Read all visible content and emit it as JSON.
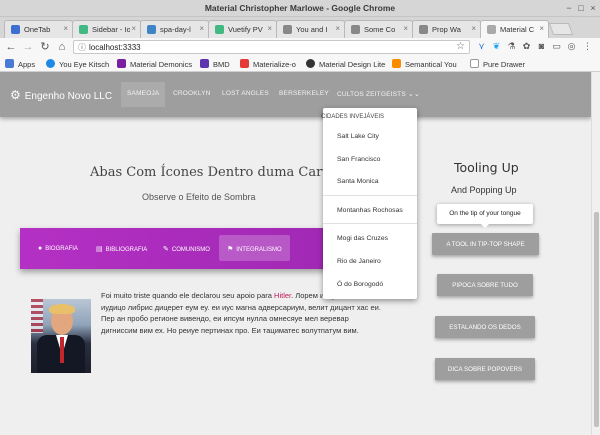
{
  "window": {
    "title": "Material Christopher Marlowe - Google Chrome"
  },
  "tabs": [
    {
      "label": "OneTab",
      "color": "#3b6fd1"
    },
    {
      "label": "Sidebar - Ionic",
      "color": "#42b883"
    },
    {
      "label": "spa-day-l",
      "color": "#3d85c6"
    },
    {
      "label": "Vuetify PV",
      "color": "#42b883"
    },
    {
      "label": "You and I",
      "color": "#666666"
    },
    {
      "label": "Some Co",
      "color": "#777777"
    },
    {
      "label": "Prop Wa",
      "color": "#777777"
    },
    {
      "label": "Material C",
      "color": "#999999"
    }
  ],
  "address": {
    "url": "localhost:3333"
  },
  "bookmarks": [
    {
      "label": "Apps",
      "color": "#4a7bd4"
    },
    {
      "label": "You Eye Kitsch",
      "color": "#1e88e5"
    },
    {
      "label": "Material Demonics",
      "color": "#7b1fa2"
    },
    {
      "label": "BMD",
      "color": "#5e35b1"
    },
    {
      "label": "Materialize-o",
      "color": "#e53935"
    },
    {
      "label": "Material Design Lite",
      "color": "#333333"
    },
    {
      "label": "Semantical You",
      "color": "#fb8c00"
    },
    {
      "label": "Pure Drawer",
      "color": "#ffffff"
    }
  ],
  "appnav": {
    "brand": "Engenho Novo LLC",
    "items": [
      "SAMEOJA",
      "CROOKLYN",
      "LOST ANGLES",
      "BERSERKELEY",
      "CULTOS ZEITGEISTS"
    ]
  },
  "dropdown": {
    "header": "CIDADES INVEJÁVEIS",
    "group1": [
      "Salt Lake City",
      "San Francisco",
      "Santa Monica"
    ],
    "group2": [
      "Montanhas Rochosas"
    ],
    "group3": [
      "Mogi das Cruzes",
      "Rio de Janeiro",
      "Ó do Borogodó"
    ]
  },
  "hero": {
    "title": "Abas Com Ícones Dentro duma Carta",
    "subtitle": "Observe o Efeito de Sombra"
  },
  "cardtabs": [
    "BIOGRAFIA",
    "BIBLIOGRAFIA",
    "COMUNISMO",
    "INTEGRALISMO"
  ],
  "body": {
    "line1_pre": "Foi muito triste quando ele declarou seu apoio para ",
    "line1_link": "Hitler",
    "line1_post": ". Лорем ипсум",
    "rest": "амет, иудицо либрис дицерет еум еу. еи иус магна адверсариум, велит дицант хас еи. Пер ан пробо регионе вивендо, еи ипсум нулла омнесяуе мел веревар дигниссим вим ех. Но реиуе пертинах про. Еи тациматес волутпатум вим."
  },
  "right": {
    "title": "Tooling Up",
    "subtitle": "And Popping Up",
    "tooltip": "On the tip of your tongue",
    "buttons": [
      "A TOOL IN TIP-TOP SHAPE",
      "PIPOCA SOBRE TUDO",
      "ESTALANDO OS DEDOS",
      "DICA SOBRE POPOVERS"
    ]
  }
}
